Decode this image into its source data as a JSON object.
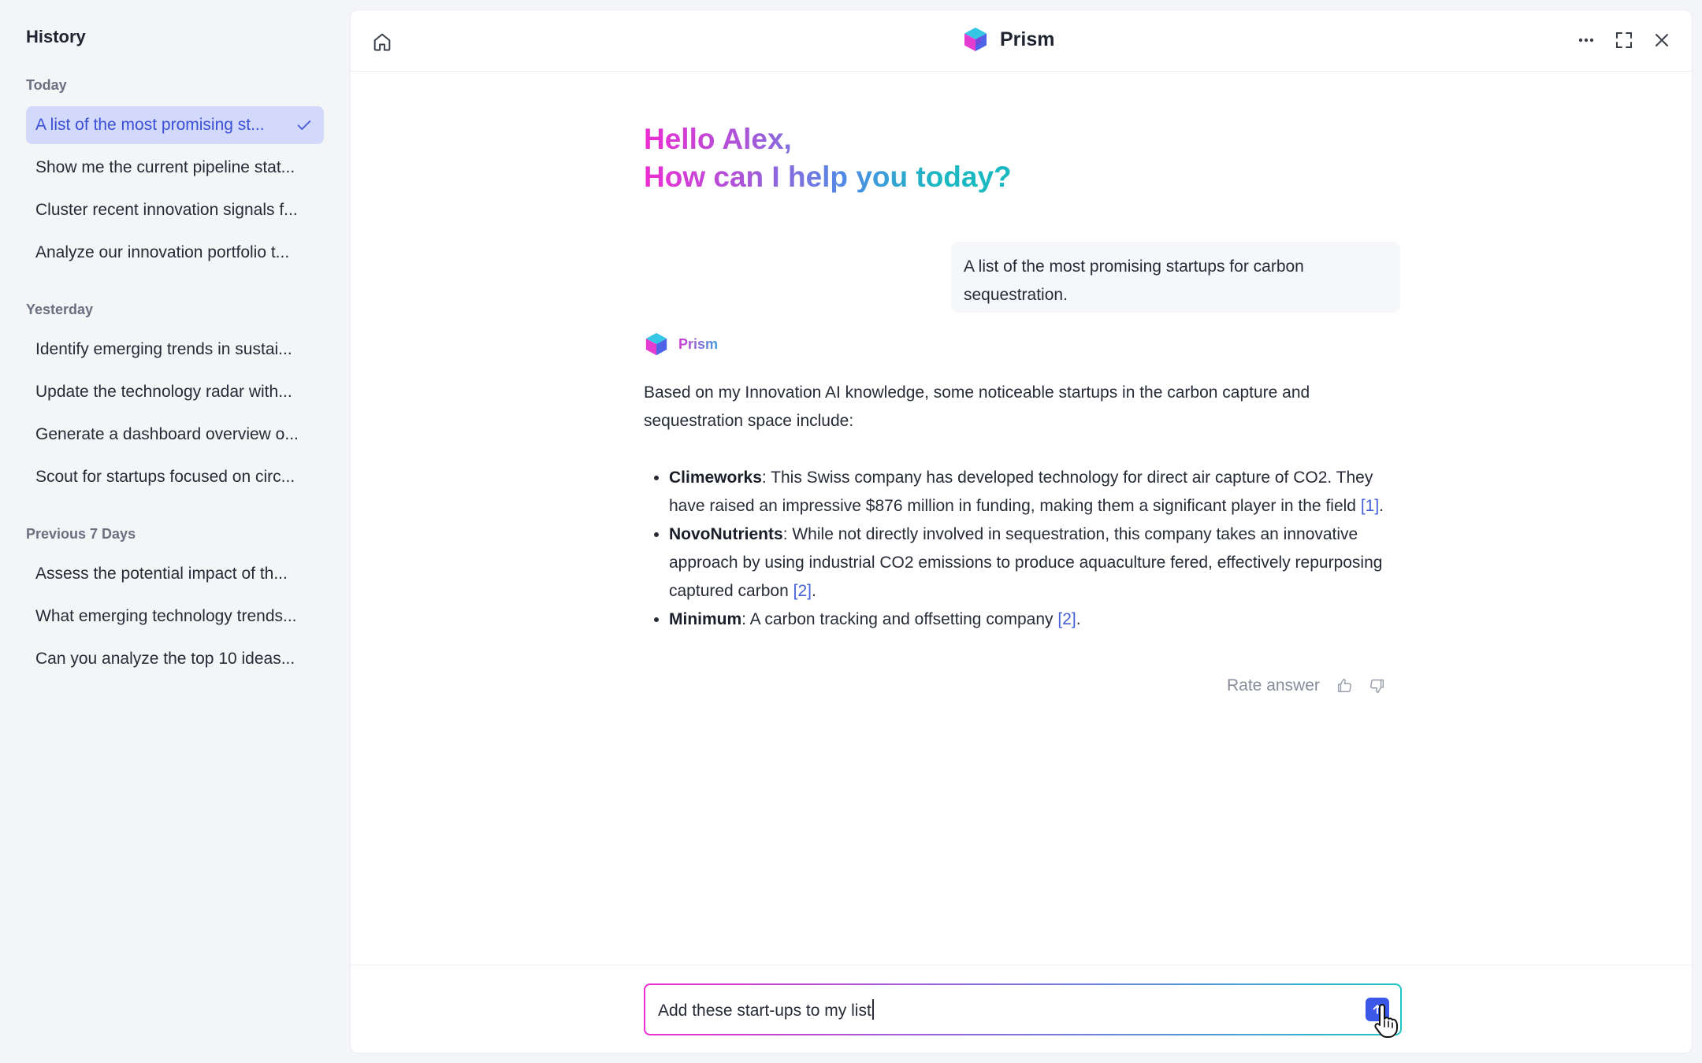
{
  "sidebar": {
    "title": "History",
    "groups": [
      {
        "label": "Today",
        "items": [
          {
            "label": "A list of the most promising st...",
            "active": true
          },
          {
            "label": "Show me the current pipeline stat..."
          },
          {
            "label": "Cluster recent innovation signals f..."
          },
          {
            "label": "Analyze our innovation portfolio t..."
          }
        ]
      },
      {
        "label": "Yesterday",
        "items": [
          {
            "label": "Identify emerging trends in sustai..."
          },
          {
            "label": "Update the technology radar with..."
          },
          {
            "label": "Generate a dashboard overview o..."
          },
          {
            "label": "Scout for startups focused on circ..."
          }
        ]
      },
      {
        "label": "Previous 7 Days",
        "items": [
          {
            "label": "Assess the potential impact of th..."
          },
          {
            "label": "What emerging technology trends..."
          },
          {
            "label": "Can you analyze the top 10 ideas..."
          }
        ]
      }
    ]
  },
  "header": {
    "app_name": "Prism"
  },
  "greeting": {
    "line1": "Hello Alex,",
    "line2": "How can I help you today?"
  },
  "conversation": {
    "user_message": "A list of the most promising startups for carbon sequestration.",
    "bot_name": "Prism",
    "bot_intro": "Based on my Innovation AI knowledge, some noticeable startups in the carbon capture and sequestration space include:",
    "bullets": [
      {
        "name": "Climeworks",
        "text": ": This Swiss company has developed technology for direct air capture of CO2. They have raised an impressive $876 million in funding, making them a significant player in the field ",
        "cite": "[1]",
        "end": "."
      },
      {
        "name": "NovoNutrients",
        "text": ": While not directly involved in sequestration, this company takes an innovative approach by using industrial CO2 emissions to produce aquaculture fered, effectively repurposing captured carbon ",
        "cite": "[2]",
        "end": "."
      },
      {
        "name": "Minimum",
        "text": ": A carbon tracking and offsetting company ",
        "cite": "[2]",
        "end": "."
      }
    ],
    "rate_label": "Rate answer"
  },
  "composer": {
    "value": "Add these start-ups to my list"
  },
  "icons": {
    "home": "home-icon",
    "more": "more-horizontal-icon",
    "expand": "expand-icon",
    "close": "close-icon",
    "check": "check-icon",
    "thumbs_up": "thumbs-up-icon",
    "thumbs_down": "thumbs-down-icon",
    "send": "arrow-up-icon",
    "cursor": "hand-pointer-icon"
  },
  "colors": {
    "accent": "#3b57e8",
    "active_item_bg": "#d2d9fb",
    "active_item_text": "#3b4fd6",
    "gradient_start": "#ee2cd3",
    "gradient_end": "#1ab8c0",
    "citation": "#4360d6"
  }
}
